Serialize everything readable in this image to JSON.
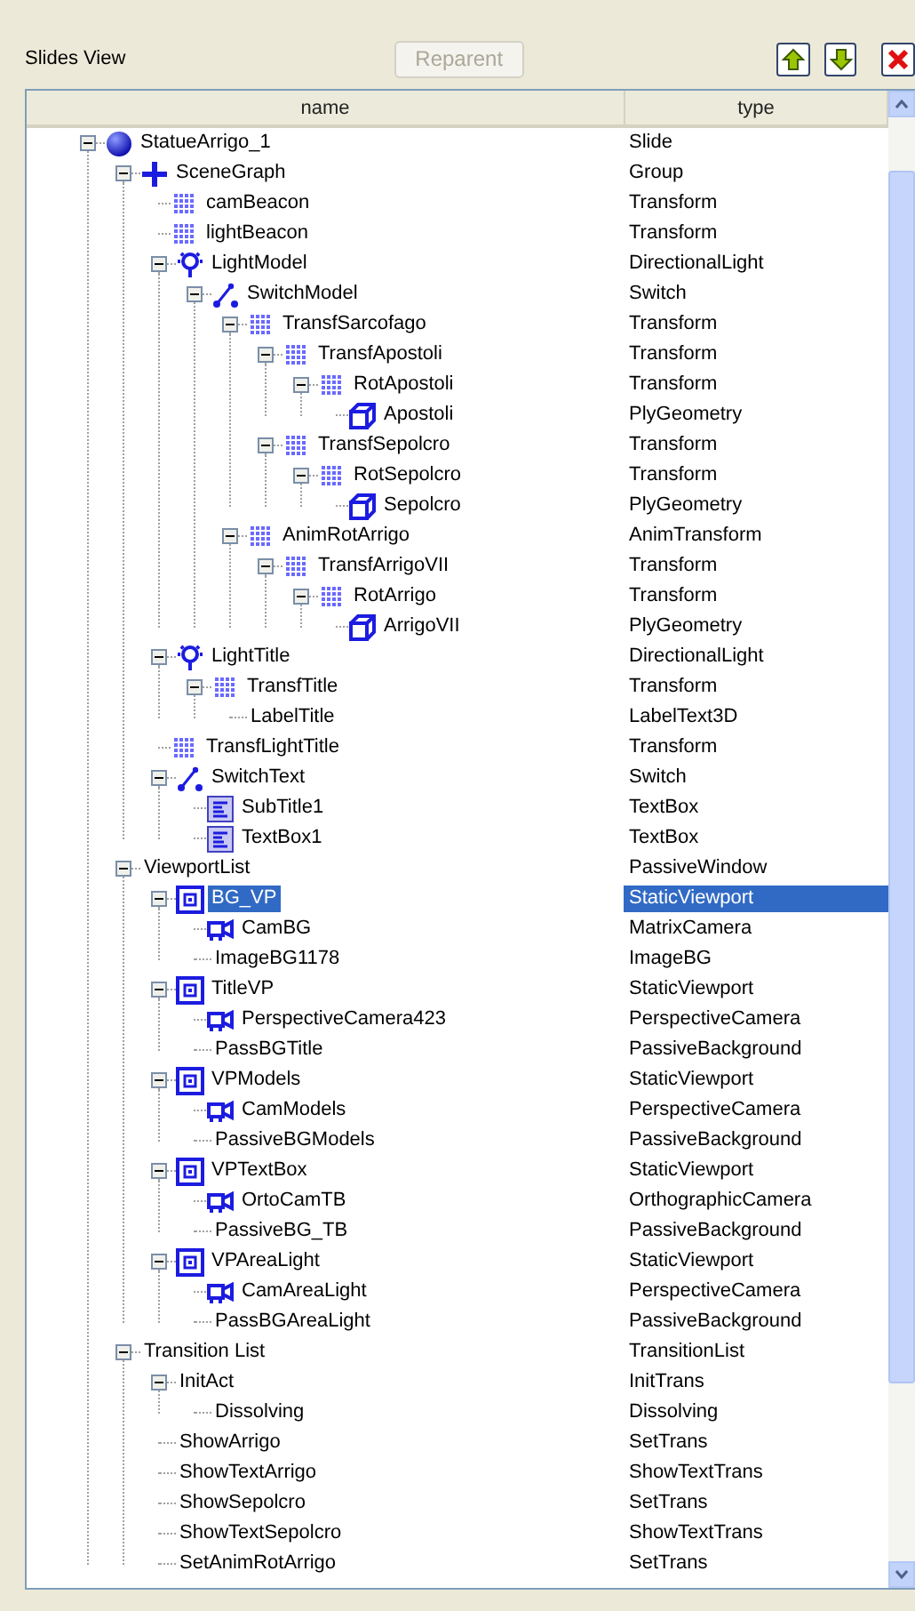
{
  "toolbar": {
    "title": "Slides View",
    "reparent_button": {
      "label": "Reparent",
      "disabled": true
    }
  },
  "table": {
    "columns": [
      "name",
      "type"
    ],
    "tree": [
      {
        "name": "StatueArrigo_1",
        "type": "Slide",
        "kind": "sphere",
        "selected": false,
        "expanded": true,
        "children": [
          {
            "name": "SceneGraph",
            "type": "Group",
            "kind": "cross",
            "selected": false,
            "expanded": true,
            "children": [
              {
                "name": "camBeacon",
                "type": "Transform",
                "kind": "grid",
                "selected": false
              },
              {
                "name": "lightBeacon",
                "type": "Transform",
                "kind": "grid",
                "selected": false
              },
              {
                "name": "LightModel",
                "type": "DirectionalLight",
                "kind": "bulb",
                "selected": false,
                "expanded": true,
                "children": [
                  {
                    "name": "SwitchModel",
                    "type": "Switch",
                    "kind": "switch",
                    "selected": false,
                    "expanded": true,
                    "children": [
                      {
                        "name": "TransfSarcofago",
                        "type": "Transform",
                        "kind": "grid",
                        "selected": false,
                        "expanded": true,
                        "children": [
                          {
                            "name": "TransfApostoli",
                            "type": "Transform",
                            "kind": "grid",
                            "selected": false,
                            "expanded": true,
                            "children": [
                              {
                                "name": "RotApostoli",
                                "type": "Transform",
                                "kind": "grid",
                                "selected": false,
                                "expanded": true,
                                "children": [
                                  {
                                    "name": "Apostoli",
                                    "type": "PlyGeometry",
                                    "kind": "cube",
                                    "selected": false
                                  }
                                ]
                              }
                            ]
                          },
                          {
                            "name": "TransfSepolcro",
                            "type": "Transform",
                            "kind": "grid",
                            "selected": false,
                            "expanded": true,
                            "children": [
                              {
                                "name": "RotSepolcro",
                                "type": "Transform",
                                "kind": "grid",
                                "selected": false,
                                "expanded": true,
                                "children": [
                                  {
                                    "name": "Sepolcro",
                                    "type": "PlyGeometry",
                                    "kind": "cube",
                                    "selected": false
                                  }
                                ]
                              }
                            ]
                          }
                        ]
                      },
                      {
                        "name": "AnimRotArrigo",
                        "type": "AnimTransform",
                        "kind": "grid",
                        "selected": false,
                        "expanded": true,
                        "children": [
                          {
                            "name": "TransfArrigoVII",
                            "type": "Transform",
                            "kind": "grid",
                            "selected": false,
                            "expanded": true,
                            "children": [
                              {
                                "name": "RotArrigo",
                                "type": "Transform",
                                "kind": "grid",
                                "selected": false,
                                "expanded": true,
                                "children": [
                                  {
                                    "name": "ArrigoVII",
                                    "type": "PlyGeometry",
                                    "kind": "cube",
                                    "selected": false
                                  }
                                ]
                              }
                            ]
                          }
                        ]
                      }
                    ]
                  }
                ]
              },
              {
                "name": "LightTitle",
                "type": "DirectionalLight",
                "kind": "bulb",
                "selected": false,
                "expanded": true,
                "children": [
                  {
                    "name": "TransfTitle",
                    "type": "Transform",
                    "kind": "grid",
                    "selected": false,
                    "expanded": true,
                    "children": [
                      {
                        "name": "LabelTitle",
                        "type": "LabelText3D",
                        "kind": "none",
                        "selected": false
                      }
                    ]
                  }
                ]
              },
              {
                "name": "TransfLightTitle",
                "type": "Transform",
                "kind": "grid",
                "selected": false
              },
              {
                "name": "SwitchText",
                "type": "Switch",
                "kind": "switch",
                "selected": false,
                "expanded": true,
                "children": [
                  {
                    "name": "SubTitle1",
                    "type": "TextBox",
                    "kind": "textbox",
                    "selected": false
                  },
                  {
                    "name": "TextBox1",
                    "type": "TextBox",
                    "kind": "textbox",
                    "selected": false
                  }
                ]
              }
            ]
          },
          {
            "name": "ViewportList",
            "type": "PassiveWindow",
            "kind": "none",
            "selected": false,
            "expanded": true,
            "children": [
              {
                "name": "BG_VP",
                "type": "StaticViewport",
                "kind": "viewport",
                "selected": true,
                "expanded": true,
                "children": [
                  {
                    "name": "CamBG",
                    "type": "MatrixCamera",
                    "kind": "camera",
                    "selected": false
                  },
                  {
                    "name": "ImageBG1178",
                    "type": "ImageBG",
                    "kind": "none",
                    "selected": false
                  }
                ]
              },
              {
                "name": "TitleVP",
                "type": "StaticViewport",
                "kind": "viewport",
                "selected": false,
                "expanded": true,
                "children": [
                  {
                    "name": "PerspectiveCamera423",
                    "type": "PerspectiveCamera",
                    "kind": "camera",
                    "selected": false
                  },
                  {
                    "name": "PassBGTitle",
                    "type": "PassiveBackground",
                    "kind": "none",
                    "selected": false
                  }
                ]
              },
              {
                "name": "VPModels",
                "type": "StaticViewport",
                "kind": "viewport",
                "selected": false,
                "expanded": true,
                "children": [
                  {
                    "name": "CamModels",
                    "type": "PerspectiveCamera",
                    "kind": "camera",
                    "selected": false
                  },
                  {
                    "name": "PassiveBGModels",
                    "type": "PassiveBackground",
                    "kind": "none",
                    "selected": false
                  }
                ]
              },
              {
                "name": "VPTextBox",
                "type": "StaticViewport",
                "kind": "viewport",
                "selected": false,
                "expanded": true,
                "children": [
                  {
                    "name": "OrtoCamTB",
                    "type": "OrthographicCamera",
                    "kind": "camera",
                    "selected": false
                  },
                  {
                    "name": "PassiveBG_TB",
                    "type": "PassiveBackground",
                    "kind": "none",
                    "selected": false
                  }
                ]
              },
              {
                "name": "VPAreaLight",
                "type": "StaticViewport",
                "kind": "viewport",
                "selected": false,
                "expanded": true,
                "children": [
                  {
                    "name": "CamAreaLight",
                    "type": "PerspectiveCamera",
                    "kind": "camera",
                    "selected": false
                  },
                  {
                    "name": "PassBGAreaLight",
                    "type": "PassiveBackground",
                    "kind": "none",
                    "selected": false
                  }
                ]
              }
            ]
          },
          {
            "name": "Transition List",
            "type": "TransitionList",
            "kind": "none",
            "selected": false,
            "expanded": true,
            "children": [
              {
                "name": "InitAct",
                "type": "InitTrans",
                "kind": "none",
                "selected": false,
                "expanded": true,
                "children": [
                  {
                    "name": "Dissolving",
                    "type": "Dissolving",
                    "kind": "none",
                    "selected": false
                  }
                ]
              },
              {
                "name": "ShowArrigo",
                "type": "SetTrans",
                "kind": "none",
                "selected": false
              },
              {
                "name": "ShowTextArrigo",
                "type": "ShowTextTrans",
                "kind": "none",
                "selected": false
              },
              {
                "name": "ShowSepolcro",
                "type": "SetTrans",
                "kind": "none",
                "selected": false
              },
              {
                "name": "ShowTextSepolcro",
                "type": "ShowTextTrans",
                "kind": "none",
                "selected": false
              },
              {
                "name": "SetAnimRotArrigo",
                "type": "SetTrans",
                "kind": "none",
                "selected": false
              }
            ]
          }
        ]
      }
    ]
  }
}
